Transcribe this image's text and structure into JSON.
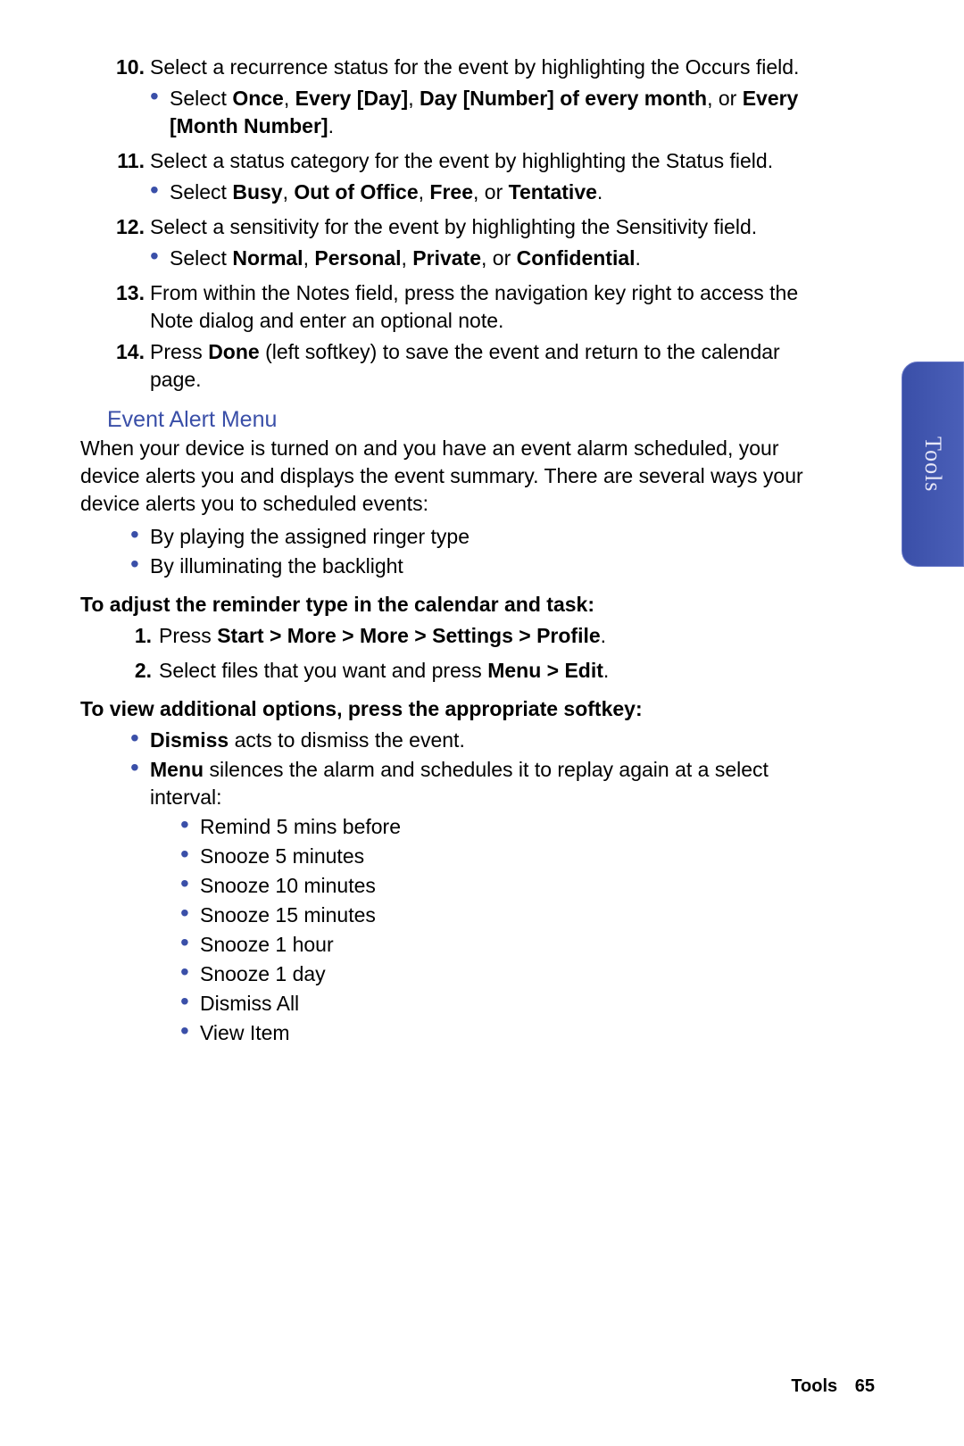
{
  "sideTab": "Tools",
  "footer": {
    "section": "Tools",
    "page": "65"
  },
  "steps": {
    "s10": {
      "num": "10.",
      "text": "Select a recurrence status for the event by highlighting the Occurs field."
    },
    "s10b": {
      "pre": "Select ",
      "b1": "Once",
      "c1": ", ",
      "b2": "Every [Day]",
      "c2": ", ",
      "b3": "Day [Number] of every month",
      "c3": ", or ",
      "b4": "Every [Month Number]",
      "post": "."
    },
    "s11": {
      "num": "11.",
      "text": "Select a status category for the event by highlighting the Status field."
    },
    "s11b": {
      "pre": "Select ",
      "b1": "Busy",
      "c1": ", ",
      "b2": "Out of Office",
      "c2": ", ",
      "b3": "Free",
      "c3": ", or ",
      "b4": "Tentative",
      "post": "."
    },
    "s12": {
      "num": "12.",
      "text": "Select a sensitivity for the event by highlighting the Sensitivity field."
    },
    "s12b": {
      "pre": "Select ",
      "b1": "Normal",
      "c1": ", ",
      "b2": "Personal",
      "c2": ", ",
      "b3": "Private",
      "c3": ", or ",
      "b4": "Confidential",
      "post": "."
    },
    "s13": {
      "num": "13.",
      "text": "From within the Notes field, press the navigation key right to access the Note dialog and enter an optional note."
    },
    "s14": {
      "num": "14.",
      "pre": "Press ",
      "b1": "Done",
      "post": " (left softkey) to save the event and return to the calendar page."
    }
  },
  "sectionTitle": "Event Alert Menu",
  "intro": "When your device is turned on and you have an event alarm scheduled, your device alerts you and displays the event summary. There are several ways your device alerts you to scheduled events:",
  "introBullets": [
    "By playing the assigned ringer type",
    "By illuminating the backlight"
  ],
  "adjustTitle": "To adjust the reminder type in the calendar and task:",
  "adjustSteps": {
    "a1": {
      "num": "1.",
      "pre": "Press ",
      "b1": "Start > More > More > Settings > Profile",
      "post": "."
    },
    "a2": {
      "num": "2.",
      "pre": "Select files that you want and press ",
      "b1": "Menu > Edit",
      "post": "."
    }
  },
  "viewTitle": "To view additional options, press the appropriate softkey:",
  "viewBullets": {
    "v1": {
      "b1": "Dismiss",
      "post": " acts to dismiss the event."
    },
    "v2": {
      "b1": "Menu",
      "post": " silences the alarm and schedules it to replay again at a select interval:"
    }
  },
  "nested": [
    "Remind 5 mins before",
    "Snooze 5 minutes",
    "Snooze 10 minutes",
    "Snooze 15 minutes",
    "Snooze 1 hour",
    "Snooze 1 day",
    "Dismiss All",
    "View Item"
  ]
}
